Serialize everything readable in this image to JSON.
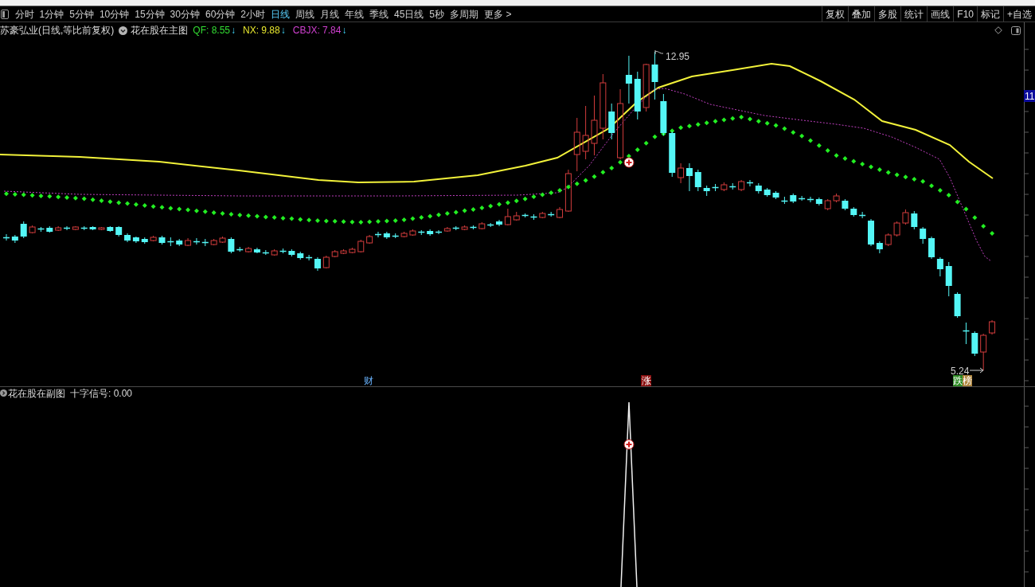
{
  "toolbar": {
    "periods": [
      {
        "label": "分时",
        "selected": false
      },
      {
        "label": "1分钟",
        "selected": false
      },
      {
        "label": "5分钟",
        "selected": false
      },
      {
        "label": "10分钟",
        "selected": false
      },
      {
        "label": "15分钟",
        "selected": false
      },
      {
        "label": "30分钟",
        "selected": false
      },
      {
        "label": "60分钟",
        "selected": false
      },
      {
        "label": "2小时",
        "selected": false
      },
      {
        "label": "日线",
        "selected": true
      },
      {
        "label": "周线",
        "selected": false
      },
      {
        "label": "月线",
        "selected": false
      },
      {
        "label": "年线",
        "selected": false
      },
      {
        "label": "季线",
        "selected": false
      },
      {
        "label": "45日线",
        "selected": false
      },
      {
        "label": "5秒",
        "selected": false
      },
      {
        "label": "多周期",
        "selected": false
      },
      {
        "label": "更多 >",
        "selected": false
      }
    ],
    "buttons": [
      "复权",
      "叠加",
      "多股",
      "统计",
      "画线",
      "F10",
      "标记",
      "+自选"
    ]
  },
  "main_chart": {
    "title": "苏豪弘业(日线,等比前复权)",
    "indicator": "花在股在主图",
    "readouts": [
      {
        "label": "QF: 8.55",
        "color": "#33dd33",
        "arrow": "↓"
      },
      {
        "label": "NX: 9.88",
        "color": "#e6e62e",
        "arrow": "↓"
      },
      {
        "label": "CBJX: 7.84",
        "color": "#d040d0",
        "arrow": "↓"
      }
    ],
    "high_label": "12.95",
    "low_label": "5.24",
    "axis_label": "11",
    "markers": [
      {
        "text": "财",
        "kind": "info"
      },
      {
        "text": "涨",
        "kind": "rise"
      },
      {
        "text": "跌榜",
        "kind": "drop"
      }
    ]
  },
  "sub_chart": {
    "indicator": "花在股在副图",
    "readout": "十字信号: 0.00"
  }
}
